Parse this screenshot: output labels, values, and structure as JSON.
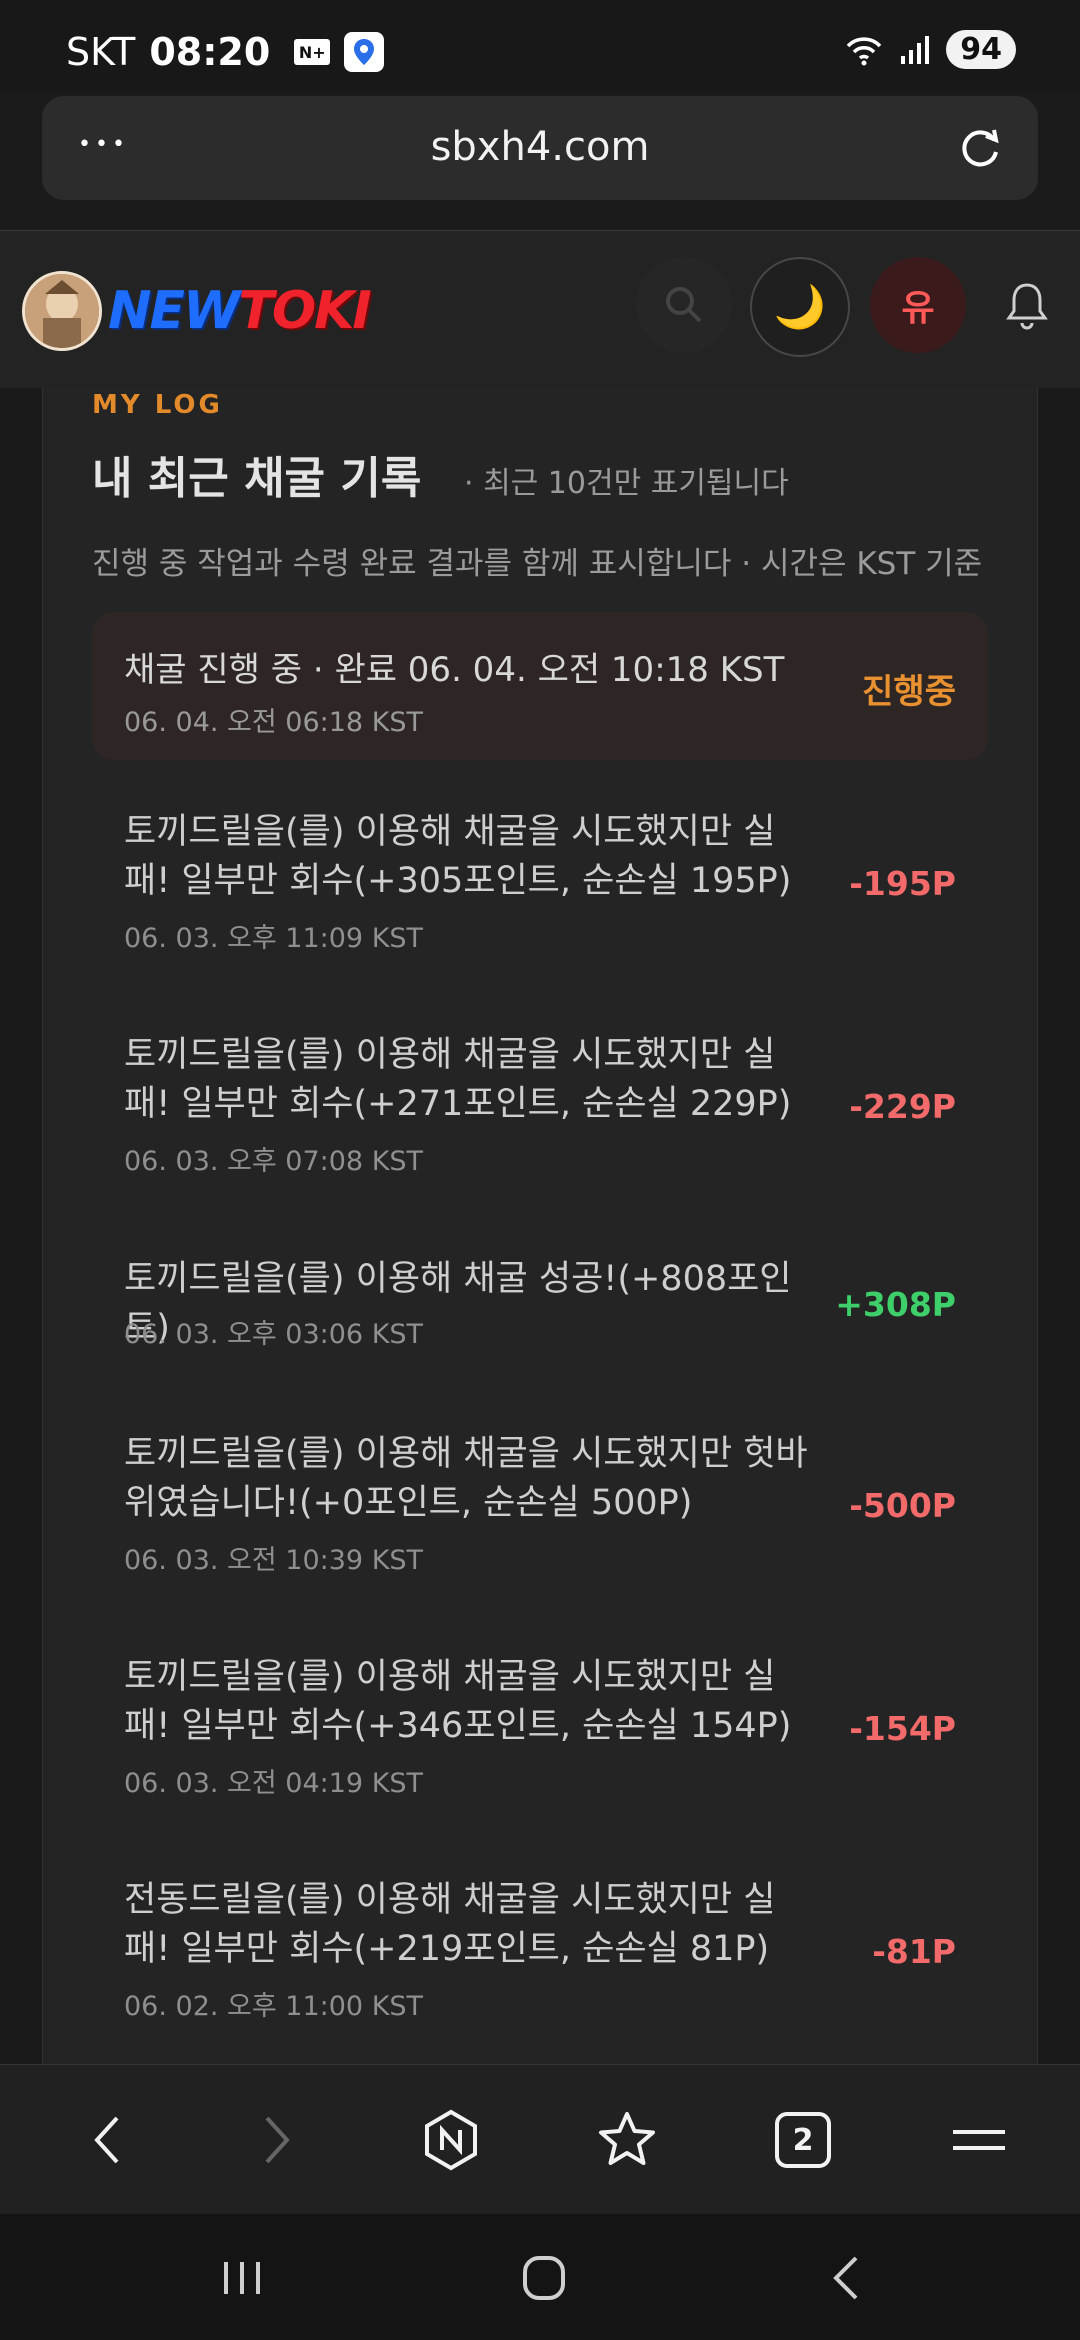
{
  "status_bar": {
    "carrier": "SKT",
    "time": "08:20",
    "n_badge": "N+",
    "battery": "94",
    "icons": [
      "wifi-icon",
      "signal-icon"
    ]
  },
  "browser": {
    "url": "sbxh4.com",
    "menu_dots": "•••",
    "tab_count": "2"
  },
  "site_header": {
    "logo_new": "NEW",
    "logo_toki": "TOKI",
    "user_initial": "유",
    "moon_icon": "🌙"
  },
  "section": {
    "eyebrow": "MY LOG",
    "title": "내 최근 채굴 기록",
    "note": "· 최근 10건만 표기됩니다",
    "description": "진행 중 작업과 수령 완료 결과를 함께 표시합니다 · 시간은 KST 기준"
  },
  "running_item": {
    "title": "채굴 진행 중 · 완료 06. 04. 오전 10:18 KST",
    "time": "06. 04. 오전 06:18 KST",
    "badge": "진행중"
  },
  "logs": [
    {
      "text": "토끼드릴을(를) 이용해 채굴을 시도했지만 실패! 일부만 회수(+305포인트, 순손실 195P)",
      "time": "06. 03. 오후 11:09 KST",
      "amount": "-195P",
      "type": "neg"
    },
    {
      "text": "토끼드릴을(를) 이용해 채굴을 시도했지만 실패! 일부만 회수(+271포인트, 순손실 229P)",
      "time": "06. 03. 오후 07:08 KST",
      "amount": "-229P",
      "type": "neg"
    },
    {
      "text": "토끼드릴을(를) 이용해 채굴 성공!(+808포인트)",
      "time": "06. 03. 오후 03:06 KST",
      "amount": "+308P",
      "type": "pos"
    },
    {
      "text": "토끼드릴을(를) 이용해 채굴을 시도했지만 헛바위였습니다!(+0포인트, 순손실 500P)",
      "time": "06. 03. 오전 10:39 KST",
      "amount": "-500P",
      "type": "neg"
    },
    {
      "text": "토끼드릴을(를) 이용해 채굴을 시도했지만 실패! 일부만 회수(+346포인트, 순손실 154P)",
      "time": "06. 03. 오전 04:19 KST",
      "amount": "-154P",
      "type": "neg"
    },
    {
      "text": "전동드릴을(를) 이용해 채굴을 시도했지만 실패! 일부만 회수(+219포인트, 순손실 81P)",
      "time": "06. 02. 오후 11:00 KST",
      "amount": "-81P",
      "type": "neg"
    }
  ]
}
